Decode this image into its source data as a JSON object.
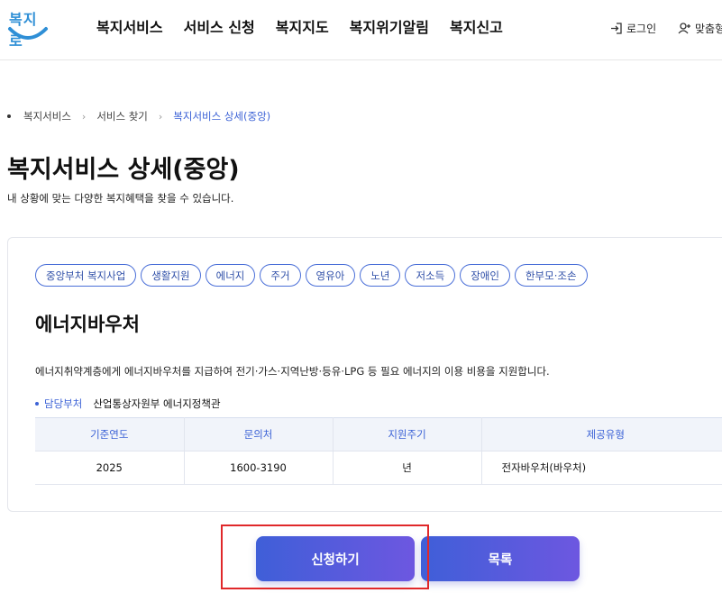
{
  "header": {
    "logo_text": "복지로",
    "nav": [
      "복지서비스",
      "서비스 신청",
      "복지지도",
      "복지위기알림",
      "복지신고"
    ],
    "login_label": "로그인",
    "custom_label": "맞춤형"
  },
  "breadcrumb": {
    "items": [
      "복지서비스",
      "서비스 찾기"
    ],
    "current": "복지서비스 상세(중앙)"
  },
  "page": {
    "title": "복지서비스 상세(중앙)",
    "subtitle": "내 상황에 맞는 다양한 복지혜택을 찾을 수 있습니다."
  },
  "service": {
    "tags": [
      "중앙부처 복지사업",
      "생활지원",
      "에너지",
      "주거",
      "영유아",
      "노년",
      "저소득",
      "장애인",
      "한부모·조손"
    ],
    "title": "에너지바우처",
    "description": "에너지취약계층에게 에너지바우처를 지급하여 전기·가스·지역난방·등유·LPG 등 필요 에너지의 이용 비용을 지원합니다.",
    "dept_label": "담당부처",
    "dept_value": "산업통상자원부 에너지정책관",
    "table": {
      "headers": [
        "기준연도",
        "문의처",
        "지원주기",
        "제공유형"
      ],
      "row": [
        "2025",
        "1600-3190",
        "년",
        "전자바우처(바우처)"
      ]
    }
  },
  "buttons": {
    "apply": "신청하기",
    "list": "목록"
  },
  "colors": {
    "accent": "#3d63d6",
    "button_gradient_start": "#3f5fd8",
    "button_gradient_end": "#6d57e0",
    "highlight": "#e0282a"
  }
}
